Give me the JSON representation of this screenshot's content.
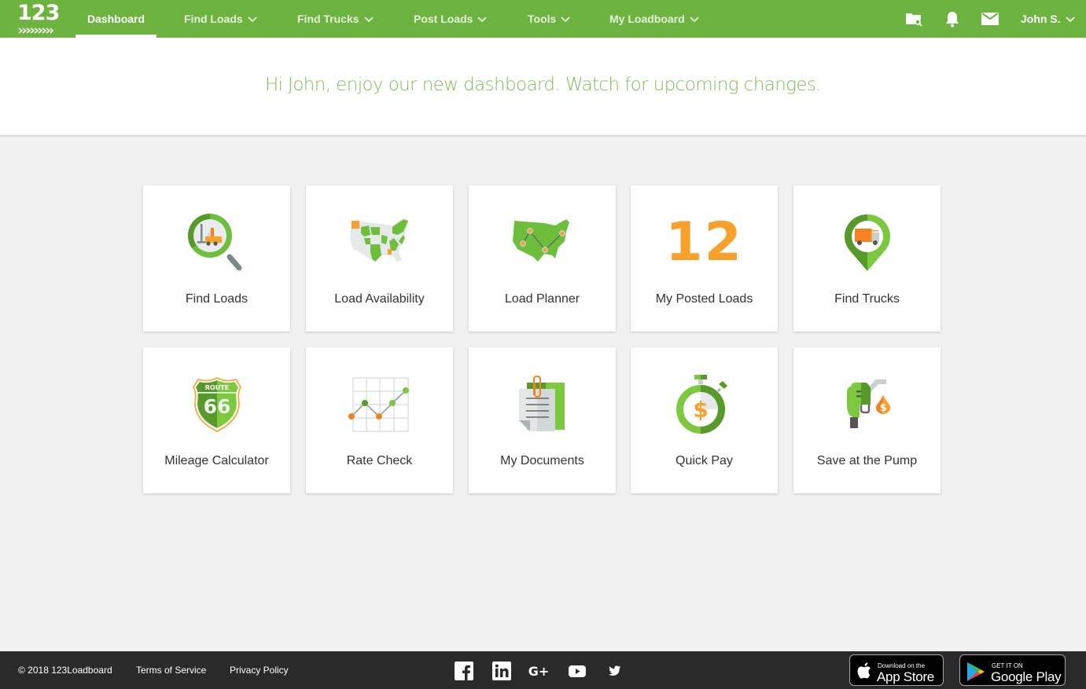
{
  "header": {
    "logo_text": "123",
    "nav": [
      {
        "label": "Dashboard",
        "active": true,
        "has_dropdown": false
      },
      {
        "label": "Find Loads",
        "has_dropdown": true
      },
      {
        "label": "Find Trucks",
        "has_dropdown": true
      },
      {
        "label": "Post Loads",
        "has_dropdown": true
      },
      {
        "label": "Tools",
        "has_dropdown": true
      },
      {
        "label": "My Loadboard",
        "has_dropdown": true
      }
    ],
    "icons": [
      "folder-search-icon",
      "bell-icon",
      "mail-icon"
    ],
    "user_label": "John S."
  },
  "banner": {
    "message": "Hi John, enjoy our new dashboard. Watch for upcoming changes."
  },
  "tiles": [
    {
      "label": "Find Loads",
      "icon": "magnifier-forklift-icon"
    },
    {
      "label": "Load Availability",
      "icon": "us-map-availability-icon"
    },
    {
      "label": "Load Planner",
      "icon": "us-map-route-icon"
    },
    {
      "label": "My Posted Loads",
      "count": "12"
    },
    {
      "label": "Find Trucks",
      "icon": "map-pin-truck-icon"
    },
    {
      "label": "Mileage Calculator",
      "icon": "route-66-shield-icon",
      "shield_top": "ROUTE",
      "shield_number": "66"
    },
    {
      "label": "Rate Check",
      "icon": "rate-chart-icon"
    },
    {
      "label": "My Documents",
      "icon": "documents-icon"
    },
    {
      "label": "Quick Pay",
      "icon": "stopwatch-dollar-icon",
      "symbol": "$"
    },
    {
      "label": "Save at the Pump",
      "icon": "fuel-nozzle-icon",
      "symbol": "$"
    }
  ],
  "footer": {
    "copyright": "© 2018 123Loadboard",
    "links": [
      "Terms of Service",
      "Privacy Policy"
    ],
    "social": [
      "facebook-icon",
      "linkedin-icon",
      "google-plus-icon",
      "youtube-icon",
      "twitter-icon"
    ],
    "google_plus_text": "G+",
    "app_store": {
      "small": "Download on the",
      "big": "App Store"
    },
    "google_play": {
      "small": "GET IT ON",
      "big": "Google Play"
    }
  },
  "colors": {
    "brand_green": "#6db33f",
    "banner_text": "#7fbd57",
    "accent_orange": "#f7a12c",
    "footer_bg": "#2b2a2b"
  }
}
